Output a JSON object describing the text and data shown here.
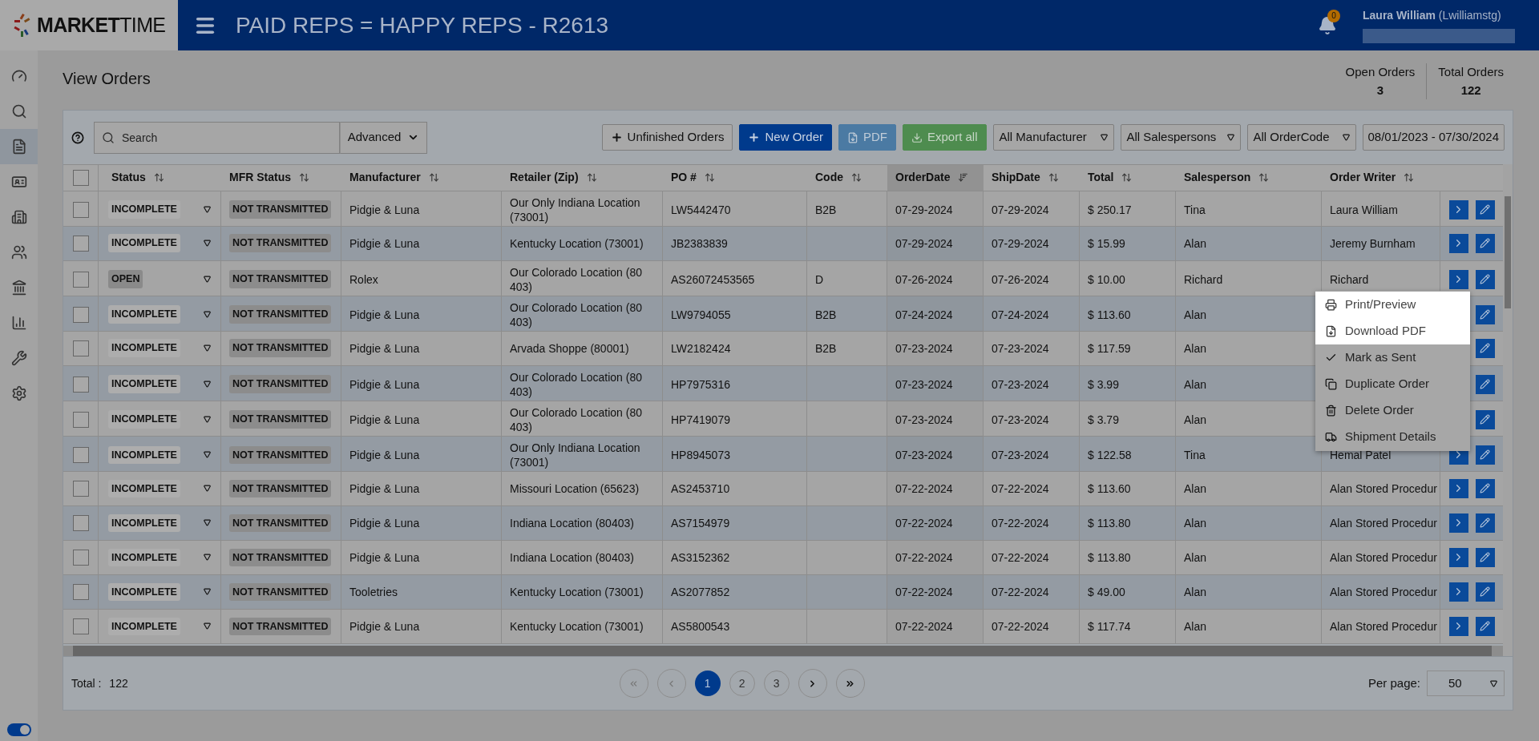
{
  "header": {
    "logo_text": {
      "bold": "MARKET",
      "light": "TIME"
    },
    "title": "PAID REPS = HAPPY REPS - R2613",
    "notifications": "0",
    "user": "**Laura William** (Lwilliamstg)"
  },
  "sidebar": {
    "items": [
      {
        "selected": false
      },
      {
        "selected": false
      },
      {
        "selected": true
      },
      {
        "selected": false
      },
      {
        "selected": false
      },
      {
        "selected": false
      },
      {
        "selected": false
      },
      {
        "selected": false
      },
      {
        "selected": false
      },
      {
        "selected": false
      }
    ],
    "toggle": {
      "on": true
    }
  },
  "page": {
    "title": "View Orders",
    "stats": [
      {
        "label": "Open Orders",
        "value": "3"
      },
      {
        "label": "Total Orders",
        "value": "122"
      }
    ]
  },
  "toolbar": {
    "search": {
      "placeholder": "Search"
    },
    "advanced": "Advanced",
    "buttons": [
      {
        "kind": "outline",
        "label": "Unfinished Orders"
      },
      {
        "kind": "primary",
        "label": "New Order"
      },
      {
        "kind": "pdf",
        "label": "PDF"
      },
      {
        "kind": "export",
        "label": "Export all"
      }
    ],
    "filters": [
      "All Manufacturer",
      "All Salespersons",
      "All OrderCode"
    ],
    "date_range": "08/01/2023 - 07/30/2024"
  },
  "table": {
    "select_all": {
      "checked": false
    },
    "columns": [
      {
        "label": "Status",
        "sorted": false
      },
      {
        "label": "MFR Status",
        "sorted": false
      },
      {
        "label": "Manufacturer",
        "sorted": false
      },
      {
        "label": "Retailer (Zip)",
        "sorted": false
      },
      {
        "label": "PO #",
        "sorted": false
      },
      {
        "label": "Code",
        "sorted": false
      },
      {
        "label": "OrderDate",
        "sorted": true
      },
      {
        "label": "ShipDate",
        "sorted": false
      },
      {
        "label": "Total",
        "sorted": false
      },
      {
        "label": "Salesperson",
        "sorted": false
      },
      {
        "label": "Order Writer",
        "sorted": false
      }
    ],
    "rows": [
      {
        "checked": false,
        "status": "INCOMPLETE",
        "kind": "incomplete",
        "mfr_status": "NOT TRANSMITTED",
        "manufacturer": "Pidgie & Luna",
        "retailer": "Our Only Indiana Location (73001)",
        "po": "LW5442470",
        "code": "B2B",
        "order_date": "07-29-2024",
        "ship_date": "07-29-2024",
        "total": "$ 250.17",
        "salesperson": "Tina",
        "order_writer": "Laura William"
      },
      {
        "checked": false,
        "status": "INCOMPLETE",
        "kind": "incomplete",
        "mfr_status": "NOT TRANSMITTED",
        "manufacturer": "Pidgie & Luna",
        "retailer": "Kentucky Location (73001)",
        "po": "JB2383839",
        "code": "",
        "order_date": "07-29-2024",
        "ship_date": "07-29-2024",
        "total": "$ 15.99",
        "salesperson": "Alan",
        "order_writer": "Jeremy Burnham"
      },
      {
        "checked": false,
        "status": "OPEN",
        "kind": "open",
        "mfr_status": "NOT TRANSMITTED",
        "manufacturer": "Rolex",
        "retailer": "Our Colorado Location (80 403)",
        "po": "AS26072453565",
        "code": "D",
        "order_date": "07-26-2024",
        "ship_date": "07-26-2024",
        "total": "$ 10.00",
        "salesperson": "Richard",
        "order_writer": "Richard"
      },
      {
        "checked": false,
        "status": "INCOMPLETE",
        "kind": "incomplete",
        "mfr_status": "NOT TRANSMITTED",
        "manufacturer": "Pidgie & Luna",
        "retailer": "Our Colorado Location (80 403)",
        "po": "LW9794055",
        "code": "B2B",
        "order_date": "07-24-2024",
        "ship_date": "07-24-2024",
        "total": "$ 113.60",
        "salesperson": "Alan",
        "order_writer": ""
      },
      {
        "checked": false,
        "status": "INCOMPLETE",
        "kind": "incomplete",
        "mfr_status": "NOT TRANSMITTED",
        "manufacturer": "Pidgie & Luna",
        "retailer": "Arvada Shoppe (80001)",
        "po": "LW2182424",
        "code": "B2B",
        "order_date": "07-23-2024",
        "ship_date": "07-23-2024",
        "total": "$ 117.59",
        "salesperson": "Alan",
        "order_writer": ""
      },
      {
        "checked": false,
        "status": "INCOMPLETE",
        "kind": "incomplete",
        "mfr_status": "NOT TRANSMITTED",
        "manufacturer": "Pidgie & Luna",
        "retailer": "Our Colorado Location (80 403)",
        "po": "HP7975316",
        "code": "",
        "order_date": "07-23-2024",
        "ship_date": "07-23-2024",
        "total": "$ 3.99",
        "salesperson": "Alan",
        "order_writer": ""
      },
      {
        "checked": false,
        "status": "INCOMPLETE",
        "kind": "incomplete",
        "mfr_status": "NOT TRANSMITTED",
        "manufacturer": "Pidgie & Luna",
        "retailer": "Our Colorado Location (80 403)",
        "po": "HP7419079",
        "code": "",
        "order_date": "07-23-2024",
        "ship_date": "07-23-2024",
        "total": "$ 3.79",
        "salesperson": "Alan",
        "order_writer": ""
      },
      {
        "checked": false,
        "status": "INCOMPLETE",
        "kind": "incomplete",
        "mfr_status": "NOT TRANSMITTED",
        "manufacturer": "Pidgie & Luna",
        "retailer": "Our Only Indiana Location (73001)",
        "po": "HP8945073",
        "code": "",
        "order_date": "07-23-2024",
        "ship_date": "07-23-2024",
        "total": "$ 122.58",
        "salesperson": "Tina",
        "order_writer": "Hemal Patel"
      },
      {
        "checked": false,
        "status": "INCOMPLETE",
        "kind": "incomplete",
        "mfr_status": "NOT TRANSMITTED",
        "manufacturer": "Pidgie & Luna",
        "retailer": "Missouri Location (65623)",
        "po": "AS2453710",
        "code": "",
        "order_date": "07-22-2024",
        "ship_date": "07-22-2024",
        "total": "$ 113.60",
        "salesperson": "Alan",
        "order_writer": "Alan Stored Procedur"
      },
      {
        "checked": false,
        "status": "INCOMPLETE",
        "kind": "incomplete",
        "mfr_status": "NOT TRANSMITTED",
        "manufacturer": "Pidgie & Luna",
        "retailer": "Indiana Location (80403)",
        "po": "AS7154979",
        "code": "",
        "order_date": "07-22-2024",
        "ship_date": "07-22-2024",
        "total": "$ 113.80",
        "salesperson": "Alan",
        "order_writer": "Alan Stored Procedur"
      },
      {
        "checked": false,
        "status": "INCOMPLETE",
        "kind": "incomplete",
        "mfr_status": "NOT TRANSMITTED",
        "manufacturer": "Pidgie & Luna",
        "retailer": "Indiana Location (80403)",
        "po": "AS3152362",
        "code": "",
        "order_date": "07-22-2024",
        "ship_date": "07-22-2024",
        "total": "$ 113.80",
        "salesperson": "Alan",
        "order_writer": "Alan Stored Procedur"
      },
      {
        "checked": false,
        "status": "INCOMPLETE",
        "kind": "incomplete",
        "mfr_status": "NOT TRANSMITTED",
        "manufacturer": "Tooletries",
        "retailer": "Kentucky Location (73001)",
        "po": "AS2077852",
        "code": "",
        "order_date": "07-22-2024",
        "ship_date": "07-22-2024",
        "total": "$ 49.00",
        "salesperson": "Alan",
        "order_writer": "Alan Stored Procedur"
      },
      {
        "checked": false,
        "status": "INCOMPLETE",
        "kind": "incomplete",
        "mfr_status": "NOT TRANSMITTED",
        "manufacturer": "Pidgie & Luna",
        "retailer": "Kentucky Location (73001)",
        "po": "AS5800543",
        "code": "",
        "order_date": "07-22-2024",
        "ship_date": "07-22-2024",
        "total": "$ 117.74",
        "salesperson": "Alan",
        "order_writer": "Alan Stored Procedur"
      }
    ]
  },
  "context_menu": {
    "items": [
      {
        "label": "Print/Preview",
        "highlighted": true
      },
      {
        "label": "Download PDF",
        "highlighted": true
      },
      {
        "label": "Mark as Sent",
        "highlighted": false
      },
      {
        "label": "Duplicate Order",
        "highlighted": false
      },
      {
        "label": "Delete Order",
        "highlighted": false
      },
      {
        "label": "Shipment Details",
        "highlighted": false
      }
    ]
  },
  "footer": {
    "total_label": "Total :",
    "total": "122",
    "pages": [
      {
        "label": "1",
        "selected": true
      },
      {
        "label": "2",
        "selected": false
      },
      {
        "label": "3",
        "selected": false
      }
    ],
    "per_page_label": "Per page:",
    "per_page": "50"
  }
}
